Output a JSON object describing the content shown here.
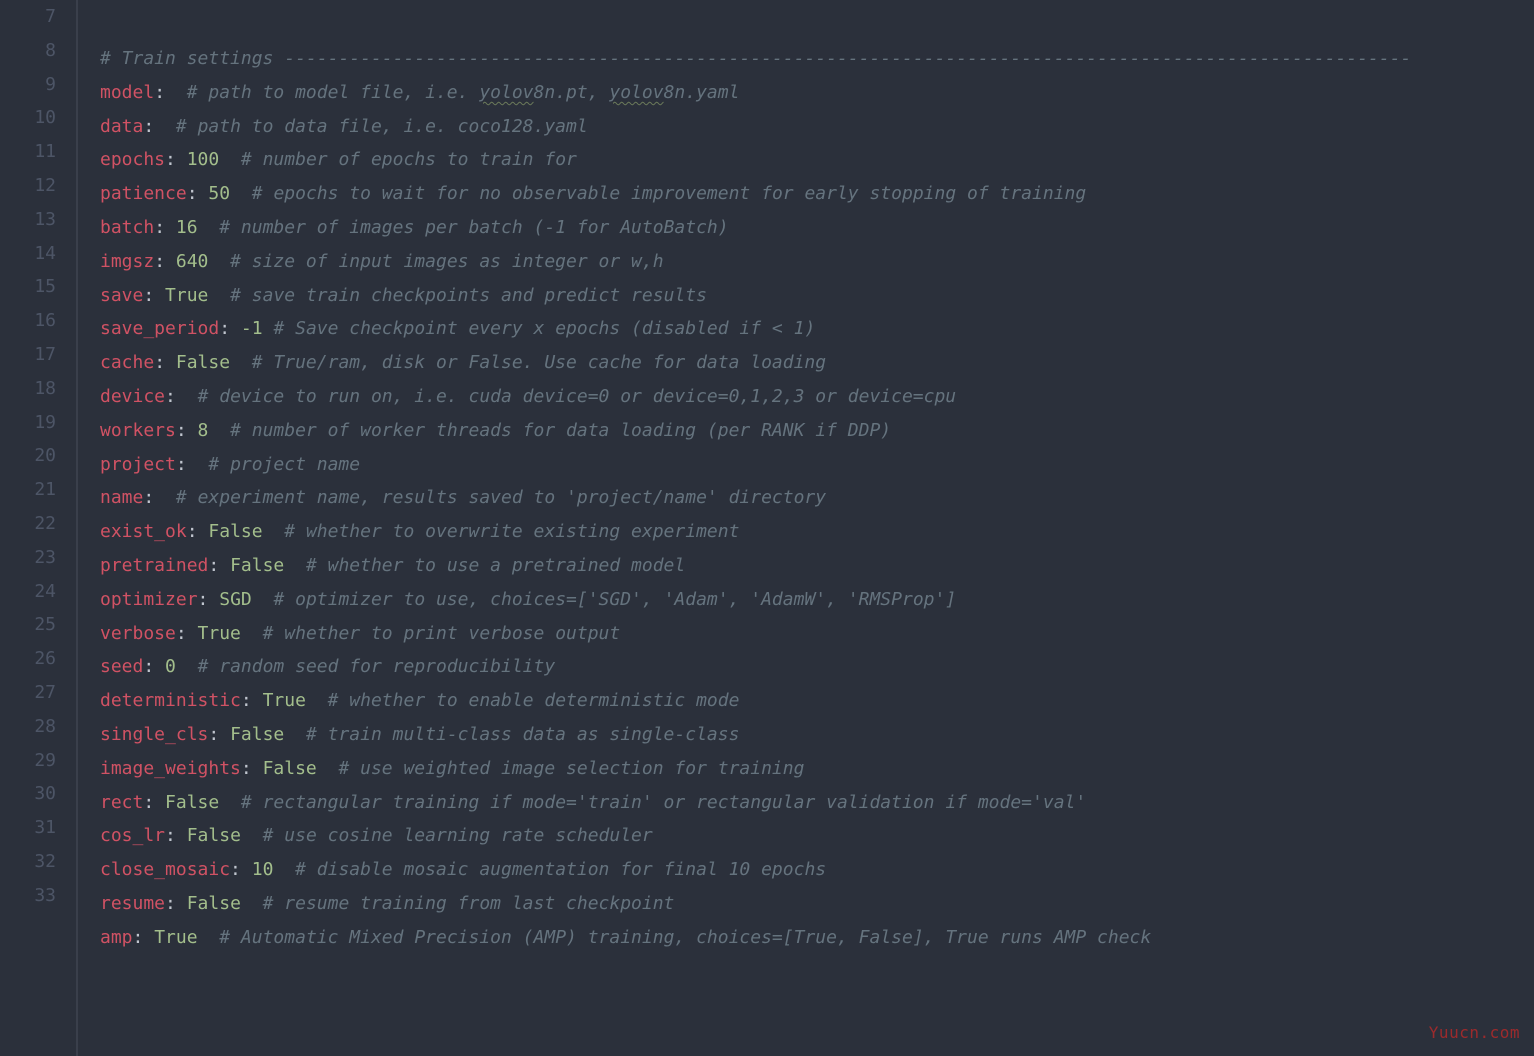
{
  "watermark": "Yuucn.com",
  "first_line_number": 7,
  "lines": [
    {
      "n": 7,
      "tokens": [
        {
          "t": "comment",
          "v": "# Train settings --------------------------------------------------------------------------------------------------------"
        }
      ]
    },
    {
      "n": 8,
      "tokens": [
        {
          "t": "key",
          "v": "model"
        },
        {
          "t": "punc",
          "v": ":"
        },
        {
          "t": "plain",
          "v": "  "
        },
        {
          "t": "comment",
          "v": "# path to model file, i.e. "
        },
        {
          "t": "underline",
          "v": "yolov"
        },
        {
          "t": "comment",
          "v": "8n.pt, "
        },
        {
          "t": "underline",
          "v": "yolov"
        },
        {
          "t": "comment",
          "v": "8n.yaml"
        }
      ]
    },
    {
      "n": 9,
      "tokens": [
        {
          "t": "key",
          "v": "data"
        },
        {
          "t": "punc",
          "v": ":"
        },
        {
          "t": "plain",
          "v": "  "
        },
        {
          "t": "comment",
          "v": "# path to data file, i.e. coco128.yaml"
        }
      ]
    },
    {
      "n": 10,
      "tokens": [
        {
          "t": "key",
          "v": "epochs"
        },
        {
          "t": "punc",
          "v": ": "
        },
        {
          "t": "num",
          "v": "100"
        },
        {
          "t": "plain",
          "v": "  "
        },
        {
          "t": "comment",
          "v": "# number of epochs to train for"
        }
      ]
    },
    {
      "n": 11,
      "tokens": [
        {
          "t": "key",
          "v": "patience"
        },
        {
          "t": "punc",
          "v": ": "
        },
        {
          "t": "num",
          "v": "50"
        },
        {
          "t": "plain",
          "v": "  "
        },
        {
          "t": "comment",
          "v": "# epochs to wait for no observable improvement for early stopping of training"
        }
      ]
    },
    {
      "n": 12,
      "tokens": [
        {
          "t": "key",
          "v": "batch"
        },
        {
          "t": "punc",
          "v": ": "
        },
        {
          "t": "num",
          "v": "16"
        },
        {
          "t": "plain",
          "v": "  "
        },
        {
          "t": "comment",
          "v": "# number of images per batch (-1 for AutoBatch)"
        }
      ]
    },
    {
      "n": 13,
      "tokens": [
        {
          "t": "key",
          "v": "imgsz"
        },
        {
          "t": "punc",
          "v": ": "
        },
        {
          "t": "num",
          "v": "640"
        },
        {
          "t": "plain",
          "v": "  "
        },
        {
          "t": "comment",
          "v": "# size of input images as integer or w,h"
        }
      ]
    },
    {
      "n": 14,
      "tokens": [
        {
          "t": "key",
          "v": "save"
        },
        {
          "t": "punc",
          "v": ": "
        },
        {
          "t": "bool",
          "v": "True"
        },
        {
          "t": "plain",
          "v": "  "
        },
        {
          "t": "comment",
          "v": "# save train checkpoints and predict results"
        }
      ]
    },
    {
      "n": 15,
      "tokens": [
        {
          "t": "key",
          "v": "save_period"
        },
        {
          "t": "punc",
          "v": ": "
        },
        {
          "t": "num",
          "v": "-1"
        },
        {
          "t": "plain",
          "v": " "
        },
        {
          "t": "comment",
          "v": "# Save checkpoint every x epochs (disabled if < 1)"
        }
      ]
    },
    {
      "n": 16,
      "tokens": [
        {
          "t": "key",
          "v": "cache"
        },
        {
          "t": "punc",
          "v": ": "
        },
        {
          "t": "bool",
          "v": "False"
        },
        {
          "t": "plain",
          "v": "  "
        },
        {
          "t": "comment",
          "v": "# True/ram, disk or False. Use cache for data loading"
        }
      ]
    },
    {
      "n": 17,
      "tokens": [
        {
          "t": "key",
          "v": "device"
        },
        {
          "t": "punc",
          "v": ":"
        },
        {
          "t": "plain",
          "v": "  "
        },
        {
          "t": "comment",
          "v": "# device to run on, i.e. cuda device=0 or device=0,1,2,3 or device=cpu"
        }
      ]
    },
    {
      "n": 18,
      "tokens": [
        {
          "t": "key",
          "v": "workers"
        },
        {
          "t": "punc",
          "v": ": "
        },
        {
          "t": "num",
          "v": "8"
        },
        {
          "t": "plain",
          "v": "  "
        },
        {
          "t": "comment",
          "v": "# number of worker threads for data loading (per RANK if DDP)"
        }
      ]
    },
    {
      "n": 19,
      "tokens": [
        {
          "t": "key",
          "v": "project"
        },
        {
          "t": "punc",
          "v": ":"
        },
        {
          "t": "plain",
          "v": "  "
        },
        {
          "t": "comment",
          "v": "# project name"
        }
      ]
    },
    {
      "n": 20,
      "tokens": [
        {
          "t": "key",
          "v": "name"
        },
        {
          "t": "punc",
          "v": ":"
        },
        {
          "t": "plain",
          "v": "  "
        },
        {
          "t": "comment",
          "v": "# experiment name, results saved to 'project/name' directory"
        }
      ]
    },
    {
      "n": 21,
      "tokens": [
        {
          "t": "key",
          "v": "exist_ok"
        },
        {
          "t": "punc",
          "v": ": "
        },
        {
          "t": "bool",
          "v": "False"
        },
        {
          "t": "plain",
          "v": "  "
        },
        {
          "t": "comment",
          "v": "# whether to overwrite existing experiment"
        }
      ]
    },
    {
      "n": 22,
      "tokens": [
        {
          "t": "key",
          "v": "pretrained"
        },
        {
          "t": "punc",
          "v": ": "
        },
        {
          "t": "bool",
          "v": "False"
        },
        {
          "t": "plain",
          "v": "  "
        },
        {
          "t": "comment",
          "v": "# whether to use a pretrained model"
        }
      ]
    },
    {
      "n": 23,
      "tokens": [
        {
          "t": "key",
          "v": "optimizer"
        },
        {
          "t": "punc",
          "v": ": "
        },
        {
          "t": "bool",
          "v": "SGD"
        },
        {
          "t": "plain",
          "v": "  "
        },
        {
          "t": "comment",
          "v": "# optimizer to use, choices=['SGD', 'Adam', 'AdamW', 'RMSProp']"
        }
      ]
    },
    {
      "n": 24,
      "tokens": [
        {
          "t": "key",
          "v": "verbose"
        },
        {
          "t": "punc",
          "v": ": "
        },
        {
          "t": "bool",
          "v": "True"
        },
        {
          "t": "plain",
          "v": "  "
        },
        {
          "t": "comment",
          "v": "# whether to print verbose output"
        }
      ]
    },
    {
      "n": 25,
      "tokens": [
        {
          "t": "key",
          "v": "seed"
        },
        {
          "t": "punc",
          "v": ": "
        },
        {
          "t": "num",
          "v": "0"
        },
        {
          "t": "plain",
          "v": "  "
        },
        {
          "t": "comment",
          "v": "# random seed for reproducibility"
        }
      ]
    },
    {
      "n": 26,
      "tokens": [
        {
          "t": "key",
          "v": "deterministic"
        },
        {
          "t": "punc",
          "v": ": "
        },
        {
          "t": "bool",
          "v": "True"
        },
        {
          "t": "plain",
          "v": "  "
        },
        {
          "t": "comment",
          "v": "# whether to enable deterministic mode"
        }
      ]
    },
    {
      "n": 27,
      "tokens": [
        {
          "t": "key",
          "v": "single_cls"
        },
        {
          "t": "punc",
          "v": ": "
        },
        {
          "t": "bool",
          "v": "False"
        },
        {
          "t": "plain",
          "v": "  "
        },
        {
          "t": "comment",
          "v": "# train multi-class data as single-class"
        }
      ]
    },
    {
      "n": 28,
      "tokens": [
        {
          "t": "key",
          "v": "image_weights"
        },
        {
          "t": "punc",
          "v": ": "
        },
        {
          "t": "bool",
          "v": "False"
        },
        {
          "t": "plain",
          "v": "  "
        },
        {
          "t": "comment",
          "v": "# use weighted image selection for training"
        }
      ]
    },
    {
      "n": 29,
      "tokens": [
        {
          "t": "key",
          "v": "rect"
        },
        {
          "t": "punc",
          "v": ": "
        },
        {
          "t": "bool",
          "v": "False"
        },
        {
          "t": "plain",
          "v": "  "
        },
        {
          "t": "comment",
          "v": "# rectangular training if mode='train' or rectangular validation if mode='val'"
        }
      ]
    },
    {
      "n": 30,
      "tokens": [
        {
          "t": "key",
          "v": "cos_lr"
        },
        {
          "t": "punc",
          "v": ": "
        },
        {
          "t": "bool",
          "v": "False"
        },
        {
          "t": "plain",
          "v": "  "
        },
        {
          "t": "comment",
          "v": "# use cosine learning rate scheduler"
        }
      ]
    },
    {
      "n": 31,
      "tokens": [
        {
          "t": "key",
          "v": "close_mosaic"
        },
        {
          "t": "punc",
          "v": ": "
        },
        {
          "t": "num",
          "v": "10"
        },
        {
          "t": "plain",
          "v": "  "
        },
        {
          "t": "comment",
          "v": "# disable mosaic augmentation for final 10 epochs"
        }
      ]
    },
    {
      "n": 32,
      "tokens": [
        {
          "t": "key",
          "v": "resume"
        },
        {
          "t": "punc",
          "v": ": "
        },
        {
          "t": "bool",
          "v": "False"
        },
        {
          "t": "plain",
          "v": "  "
        },
        {
          "t": "comment",
          "v": "# resume training from last checkpoint"
        }
      ]
    },
    {
      "n": 33,
      "tokens": [
        {
          "t": "key",
          "v": "amp"
        },
        {
          "t": "punc",
          "v": ": "
        },
        {
          "t": "bool",
          "v": "True"
        },
        {
          "t": "plain",
          "v": "  "
        },
        {
          "t": "comment",
          "v": "# Automatic Mixed Precision (AMP) training, choices=[True, False], True runs AMP check"
        }
      ]
    }
  ]
}
